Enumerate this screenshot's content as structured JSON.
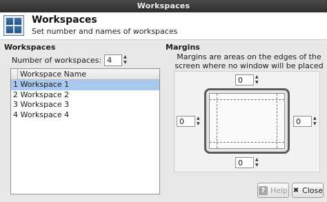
{
  "window": {
    "title": "Workspaces"
  },
  "header": {
    "title": "Workspaces",
    "subtitle": "Set number and names of workspaces",
    "icon": "workspaces-icon"
  },
  "workspaces": {
    "section_title": "Workspaces",
    "count_label": "Number of workspaces:",
    "count_value": "4",
    "list_header": "Workspace Name",
    "rows": [
      {
        "index": "1",
        "name": "Workspace 1",
        "selected": true
      },
      {
        "index": "2",
        "name": "Workspace 2",
        "selected": false
      },
      {
        "index": "3",
        "name": "Workspace 3",
        "selected": false
      },
      {
        "index": "4",
        "name": "Workspace 4",
        "selected": false
      }
    ]
  },
  "margins": {
    "section_title": "Margins",
    "description": "Margins are areas on the edges of the screen where no window will be placed",
    "top": "0",
    "left": "0",
    "right": "0",
    "bottom": "0"
  },
  "buttons": {
    "help": "Help",
    "close": "Close"
  },
  "colors": {
    "selection": "#a8c8ee",
    "titlebar": "#3a3a3a"
  }
}
